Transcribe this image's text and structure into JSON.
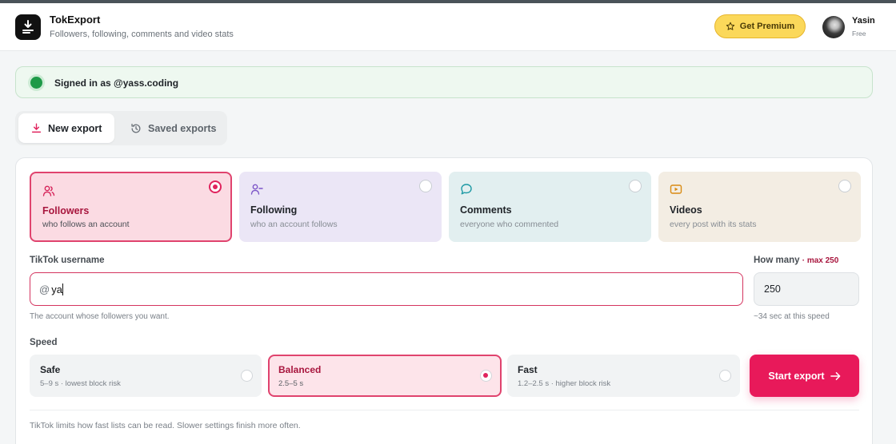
{
  "header": {
    "app_name": "TokExport",
    "subtitle": "Followers, following, comments and video stats",
    "premium_label": "Get Premium",
    "user_name": "Yasin",
    "user_plan": "Free"
  },
  "status": {
    "text": "Signed in as @yass.coding",
    "color": "#1e9a48"
  },
  "tabs": [
    {
      "label": "New export",
      "icon": "download-icon",
      "active": true
    },
    {
      "label": "Saved exports",
      "icon": "history-icon",
      "active": false
    }
  ],
  "export_types": [
    {
      "title": "Followers",
      "subtitle": "who follows an account",
      "icon": "users-icon",
      "selected": true,
      "color": "#fbdbe3"
    },
    {
      "title": "Following",
      "subtitle": "who an account follows",
      "icon": "user-minus-icon",
      "selected": false,
      "color": "#ebe6f6"
    },
    {
      "title": "Comments",
      "subtitle": "everyone who commented",
      "icon": "chat-bubble-icon",
      "selected": false,
      "color": "#e2eff0"
    },
    {
      "title": "Videos",
      "subtitle": "every post with its stats",
      "icon": "video-play-icon",
      "selected": false,
      "color": "#f3ede3"
    }
  ],
  "form": {
    "username_label": "TikTok username",
    "username_prefix": "@",
    "username_value": "ya",
    "username_hint": "The account whose followers you want.",
    "count_label": "How many",
    "count_max": "· max 250",
    "count_value": "250",
    "count_hint": "~34 sec at this speed",
    "speed_label": "Speed"
  },
  "speeds": [
    {
      "name": "Safe",
      "desc": "5–9 s · lowest block risk",
      "selected": false
    },
    {
      "name": "Balanced",
      "desc": "2.5–5 s",
      "selected": true
    },
    {
      "name": "Fast",
      "desc": "1.2–2.5 s · higher block risk",
      "selected": false
    }
  ],
  "start_label": "Start export",
  "footer_note": "TikTok limits how fast lists can be read. Slower settings finish more often.",
  "colors": {
    "accent": "#e8195a",
    "premium": "#fbd85a"
  }
}
